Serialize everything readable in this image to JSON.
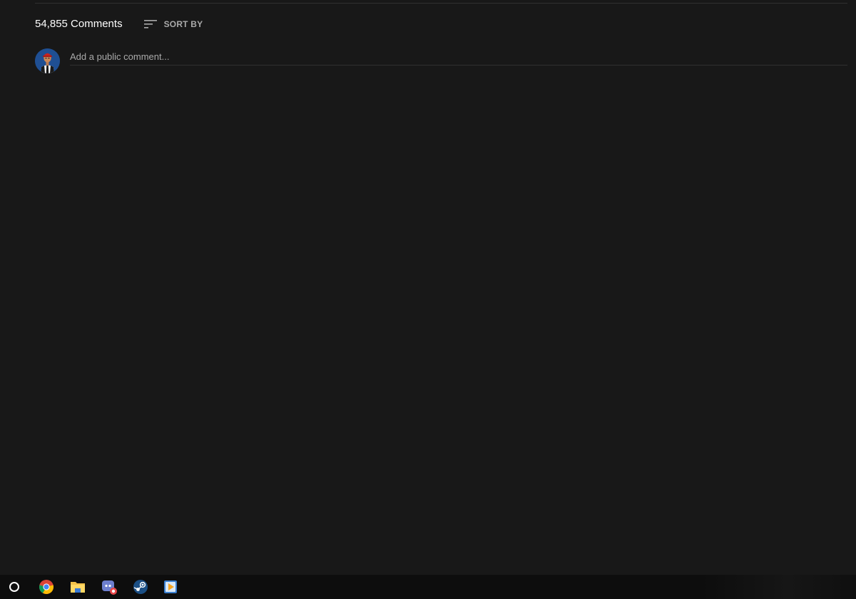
{
  "comments": {
    "count_label": "54,855 Comments",
    "sort_label": "SORT BY",
    "input_placeholder": "Add a public comment..."
  },
  "icons": {
    "sort": "sort-icon",
    "avatar": "user-avatar",
    "start": "start-button-icon",
    "chrome": "chrome-icon",
    "explorer": "file-explorer-icon",
    "discord": "discord-icon",
    "steam": "steam-icon",
    "media": "media-player-icon"
  },
  "colors": {
    "background": "#181818",
    "divider": "#303030",
    "text_primary": "#ffffff",
    "text_secondary": "#aaaaaa",
    "taskbar": "#0d0d0d"
  }
}
